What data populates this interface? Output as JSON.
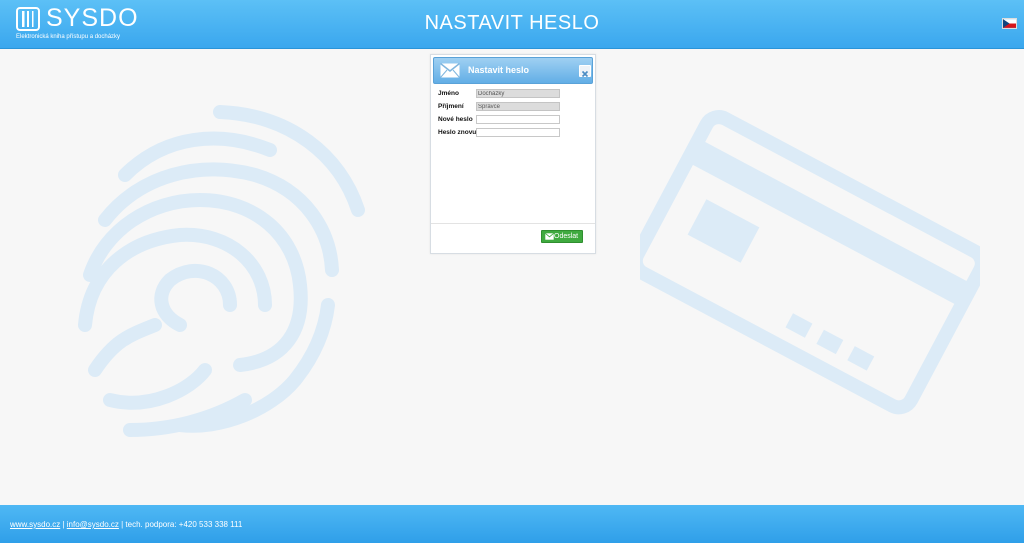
{
  "header": {
    "logo_text": "SYSDO",
    "logo_tagline": "Elektronická kniha přístupu a docházky",
    "page_title": "NASTAVIT HESLO",
    "language_flag": "czech-flag-icon"
  },
  "dialog": {
    "title": "Nastavit heslo",
    "fields": {
      "jmeno": {
        "label": "Jméno",
        "value": "Docházky"
      },
      "prijmeni": {
        "label": "Příjmení",
        "value": "Správce"
      },
      "nove_heslo": {
        "label": "Nové heslo",
        "value": ""
      },
      "heslo_znovu": {
        "label": "Heslo znovu",
        "value": ""
      }
    },
    "submit_label": "Odeslat"
  },
  "footer": {
    "website": "www.sysdo.cz",
    "separator1": " | ",
    "email": "info@sysdo.cz",
    "support": " | tech. podpora: +420 533 338 111"
  },
  "colors": {
    "header_blue": "#3aa7ee",
    "watermark_blue": "#dcebf7",
    "submit_green": "#3faa3f"
  }
}
